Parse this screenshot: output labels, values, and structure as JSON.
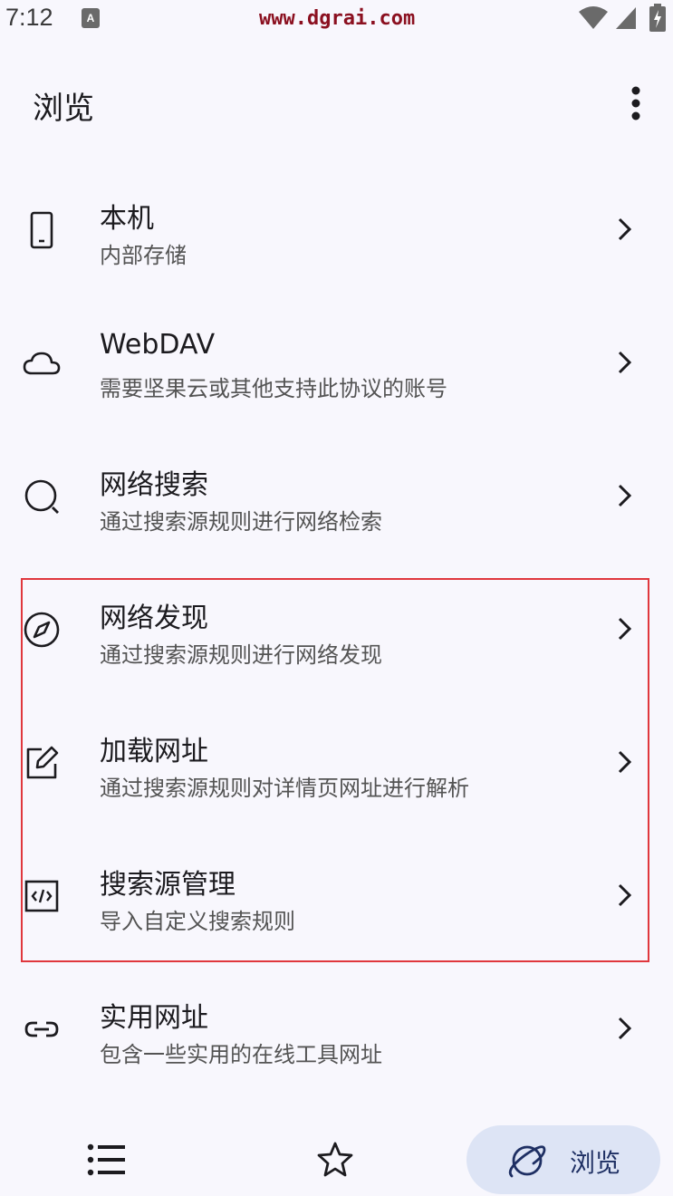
{
  "status_bar": {
    "time": "7:12",
    "watermark": "www.dgrai.com"
  },
  "app_bar": {
    "title": "浏览"
  },
  "list": {
    "items": [
      {
        "title": "本机",
        "subtitle": "内部存储",
        "icon": "phone-icon"
      },
      {
        "title": "WebDAV",
        "subtitle": "需要坚果云或其他支持此协议的账号",
        "icon": "cloud-icon"
      },
      {
        "title": "网络搜索",
        "subtitle": "通过搜索源规则进行网络检索",
        "icon": "search-icon"
      },
      {
        "title": "网络发现",
        "subtitle": "通过搜索源规则进行网络发现",
        "icon": "compass-icon"
      },
      {
        "title": "加载网址",
        "subtitle": "通过搜索源规则对详情页网址进行解析",
        "icon": "edit-icon"
      },
      {
        "title": "搜索源管理",
        "subtitle": "导入自定义搜索规则",
        "icon": "code-icon"
      },
      {
        "title": "实用网址",
        "subtitle": "包含一些实用的在线工具网址",
        "icon": "link-icon"
      }
    ]
  },
  "bottom_nav": {
    "browse_label": "浏览"
  },
  "colors": {
    "background": "#f8f7fd",
    "highlight_border": "#e0373d",
    "nav_active_pill": "#dde4f5",
    "watermark": "#8b1020"
  }
}
